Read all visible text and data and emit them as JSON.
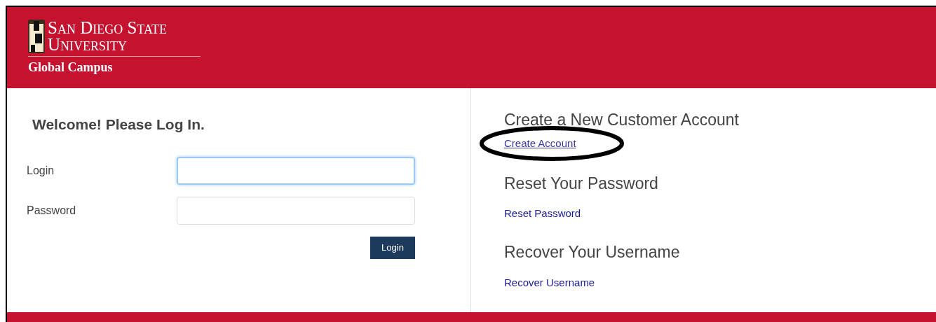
{
  "header": {
    "logo_line_1": "San Diego State",
    "logo_line_2": "University",
    "logo_subtitle": "Global Campus"
  },
  "login_panel": {
    "title": "Welcome! Please Log In.",
    "fields": [
      {
        "label": "Login",
        "focused": true
      },
      {
        "label": "Password",
        "focused": false
      }
    ],
    "button": "Login"
  },
  "account_panel": {
    "sections": [
      {
        "heading": "Create a New Customer Account",
        "link": "Create Account",
        "circled": true
      },
      {
        "heading": "Reset Your Password",
        "link": "Reset Password",
        "circled": false
      },
      {
        "heading": "Recover Your Username",
        "link": "Recover Username",
        "circled": false
      }
    ]
  }
}
